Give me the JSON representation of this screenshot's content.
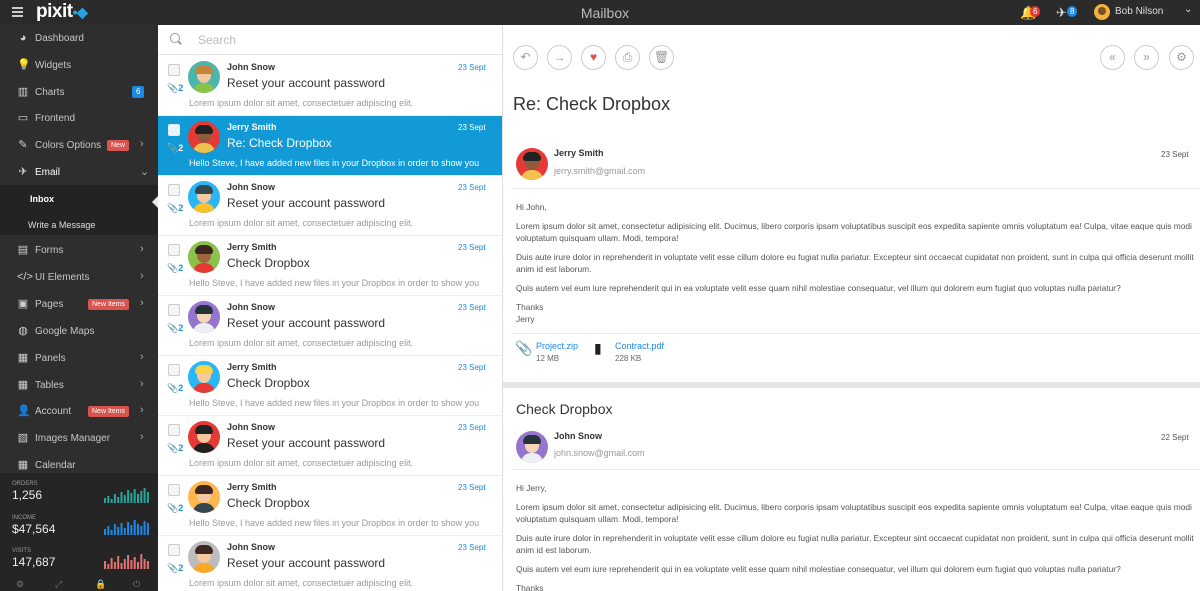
{
  "topbar": {
    "logo": "pixit",
    "title": "Mailbox",
    "notifications_count": "6",
    "messages_count": "8",
    "user_name": "Bob Nilson"
  },
  "sidebar": {
    "items": [
      {
        "label": "Dashboard",
        "icon": "dashboard-icon"
      },
      {
        "label": "Widgets",
        "icon": "lightbulb-icon"
      },
      {
        "label": "Charts",
        "icon": "bar-chart-icon",
        "count": "6"
      },
      {
        "label": "Frontend",
        "icon": "monitor-icon"
      },
      {
        "label": "Colors Options",
        "icon": "paint-brush-icon",
        "pill": "New"
      },
      {
        "label": "Email",
        "icon": "paper-plane-icon"
      },
      {
        "label": "Forms",
        "icon": "form-icon"
      },
      {
        "label": "UI Elements",
        "icon": "code-icon"
      },
      {
        "label": "Pages",
        "icon": "pages-icon",
        "pill": "New Items"
      },
      {
        "label": "Google Maps",
        "icon": "globe-icon"
      },
      {
        "label": "Panels",
        "icon": "grid-icon"
      },
      {
        "label": "Tables",
        "icon": "table-icon"
      },
      {
        "label": "Account",
        "icon": "user-icon",
        "pill": "New Items"
      },
      {
        "label": "Images Manager",
        "icon": "image-icon"
      },
      {
        "label": "Calendar",
        "icon": "calendar-icon"
      }
    ],
    "submenu": [
      "Inbox",
      "Write a Message"
    ],
    "stats": [
      {
        "label": "Orders",
        "value": "1,256",
        "color": "#26a69a"
      },
      {
        "label": "Income",
        "value": "$47,564",
        "color": "#1e88e5"
      },
      {
        "label": "Visits",
        "value": "147,687",
        "color": "#e57373"
      }
    ]
  },
  "search": {
    "placeholder": "Search"
  },
  "mails": [
    {
      "from": "John Snow",
      "date": "23 Sept",
      "subject": "Reset your account password",
      "preview": "Lorem ipsum dolor sit amet, consectetuer adipiscing elit.",
      "attachments": "2",
      "avatar_bg": "#4db6ac",
      "hair": "#c0863a",
      "skin": "#f6c89e",
      "shirt": "#8bc34a"
    },
    {
      "from": "Jerry Smith",
      "date": "23 Sept",
      "subject": "Re: Check Dropbox",
      "preview": "Hello Steve, I have added new files in your Dropbox in order to show you",
      "attachments": "2",
      "avatar_bg": "#e53935",
      "hair": "#222222",
      "skin": "#8d5a3a",
      "shirt": "#f2c14e",
      "selected": true
    },
    {
      "from": "John Snow",
      "date": "23 Sept",
      "subject": "Reset your account password",
      "preview": "Lorem ipsum dolor sit amet, consectetuer adipiscing elit.",
      "attachments": "2",
      "avatar_bg": "#29b6f6",
      "hair": "#37474f",
      "skin": "#f6c89e",
      "shirt": "#fbc02d"
    },
    {
      "from": "Jerry Smith",
      "date": "23 Sept",
      "subject": "Check Dropbox",
      "preview": "Hello Steve, I have added new files in your Dropbox in order to show you",
      "attachments": "2",
      "avatar_bg": "#8bc34a",
      "hair": "#3e2723",
      "skin": "#a0673f",
      "shirt": "#e53935"
    },
    {
      "from": "John Snow",
      "date": "23 Sept",
      "subject": "Reset your account password",
      "preview": "Lorem ipsum dolor sit amet, consectetuer adipiscing elit.",
      "attachments": "2",
      "avatar_bg": "#9575cd",
      "hair": "#263238",
      "skin": "#f6d5b8",
      "shirt": "#eceff1"
    },
    {
      "from": "Jerry Smith",
      "date": "23 Sept",
      "subject": "Check Dropbox",
      "preview": "Hello Steve, I have added new files in your Dropbox in order to show you",
      "attachments": "2",
      "avatar_bg": "#29b6f6",
      "hair": "#f9d34a",
      "skin": "#f6c89e",
      "shirt": "#e53935"
    },
    {
      "from": "John Snow",
      "date": "23 Sept",
      "subject": "Reset your account password",
      "preview": "Lorem ipsum dolor sit amet, consectetuer adipiscing elit.",
      "attachments": "2",
      "avatar_bg": "#e53935",
      "hair": "#212121",
      "skin": "#f6c89e",
      "shirt": "#212121"
    },
    {
      "from": "Jerry Smith",
      "date": "23 Sept",
      "subject": "Check Dropbox",
      "preview": "Hello Steve, I have added new files in your Dropbox in order to show you",
      "attachments": "2",
      "avatar_bg": "#ffb74d",
      "hair": "#3e2723",
      "skin": "#f6c89e",
      "shirt": "#37474f"
    },
    {
      "from": "John Snow",
      "date": "23 Sept",
      "subject": "Reset your account password",
      "preview": "Lorem ipsum dolor sit amet, consectetuer adipiscing elit.",
      "attachments": "2",
      "avatar_bg": "#bdbdbd",
      "hair": "#3e2723",
      "skin": "#f6c89e",
      "shirt": "#f9a825"
    }
  ],
  "reader": {
    "subject": "Re: Check Dropbox",
    "message1": {
      "from": "Jerry Smith",
      "email": "jerry.smith@gmail.com",
      "date": "23 Sept",
      "greeting": "Hi John,",
      "p1": "Lorem ipsum dolor sit amet, consectetur adipisicing elit. Ducimus, libero corporis ipsam voluptatibus suscipit eos expedita sapiente omnis voluptatum ea! Culpa, vitae eaque quis modi voluptatum quisquam ullam. Modi, tempora!",
      "p2": "Duis aute irure dolor in reprehenderit in voluptate velit esse cillum dolore eu fugiat nulla pariatur. Excepteur sint occaecat cupidatat non proident, sunt in culpa qui officia deserunt mollit anim id est laborum.",
      "p3": "Quis autem vel eum iure reprehenderit qui in ea voluptate velit esse quam nihil molestiae consequatur, vel illum qui dolorem eum fugiat quo voluptas nulla pariatur?",
      "signoff": "Thanks",
      "signature": "Jerry",
      "attachments": [
        {
          "name": "Project.zip",
          "size": "12 MB",
          "icon": "paperclip-icon"
        },
        {
          "name": "Contract.pdf",
          "size": "228 KB",
          "icon": "file-icon"
        }
      ]
    },
    "message2": {
      "title": "Check Dropbox",
      "from": "John Snow",
      "email": "john.snow@gmail.com",
      "date": "22 Sept",
      "greeting": "Hi Jerry,",
      "p1": "Lorem ipsum dolor sit amet, consectetur adipisicing elit. Ducimus, libero corporis ipsam voluptatibus suscipit eos expedita sapiente omnis voluptatum ea! Culpa, vitae eaque quis modi voluptatum quisquam ullam. Modi, tempora!",
      "p2": "Duis aute irure dolor in reprehenderit in voluptate velit esse cillum dolore eu fugiat nulla pariatur. Excepteur sint occaecat cupidatat non proident, sunt in culpa qui officia deserunt mollit anim id est laborum.",
      "p3": "Quis autem vel eum iure reprehenderit qui in ea voluptate velit esse quam nihil molestiae consequatur, vel illum qui dolorem eum fugiat quo voluptas nulla pariatur?",
      "signoff": "Thanks"
    }
  }
}
